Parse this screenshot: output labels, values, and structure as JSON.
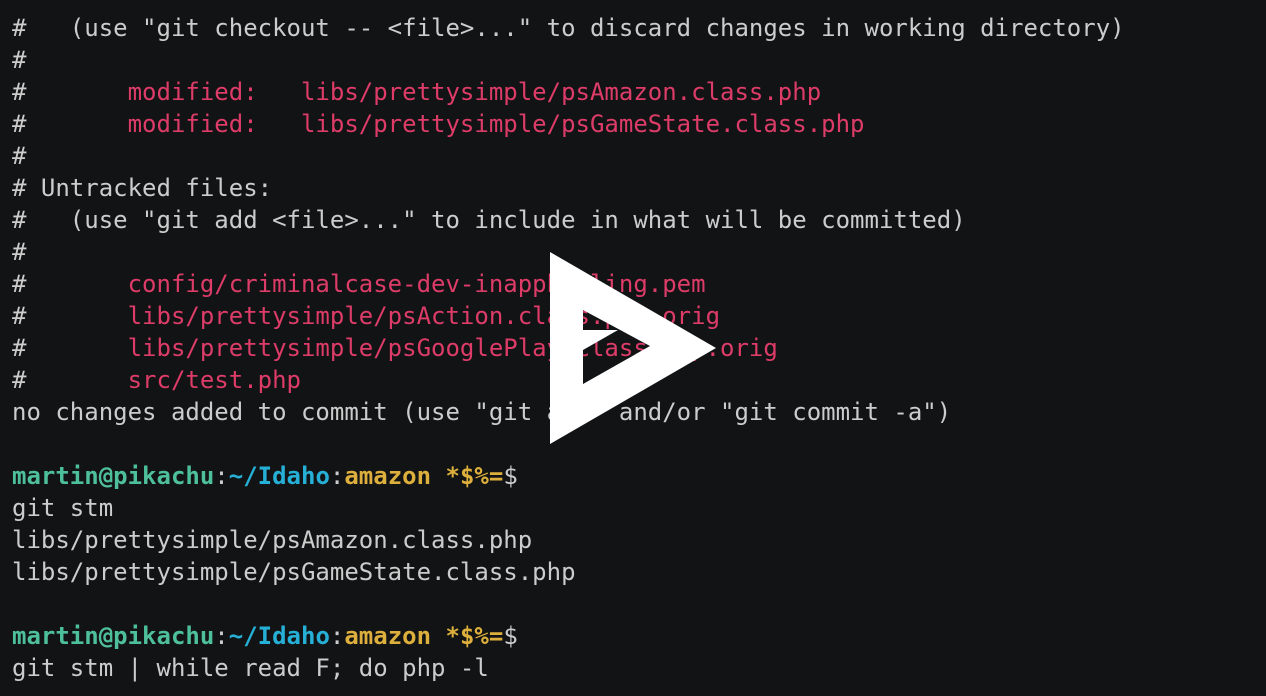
{
  "terminal": {
    "lines": [
      [
        {
          "text": "#   (use \"git checkout -- <file>...\" to discard changes in working directory)",
          "color": "default"
        }
      ],
      [
        {
          "text": "#",
          "color": "default"
        }
      ],
      [
        {
          "text": "#       ",
          "color": "default"
        },
        {
          "text": "modified:   libs/prettysimple/psAmazon.class.php",
          "color": "red"
        }
      ],
      [
        {
          "text": "#       ",
          "color": "default"
        },
        {
          "text": "modified:   libs/prettysimple/psGameState.class.php",
          "color": "red"
        }
      ],
      [
        {
          "text": "#",
          "color": "default"
        }
      ],
      [
        {
          "text": "# Untracked files:",
          "color": "default"
        }
      ],
      [
        {
          "text": "#   (use \"git add <file>...\" to include in what will be committed)",
          "color": "default"
        }
      ],
      [
        {
          "text": "#",
          "color": "default"
        }
      ],
      [
        {
          "text": "#       ",
          "color": "default"
        },
        {
          "text": "config/criminalcase-dev-inappbilling.pem",
          "color": "red"
        }
      ],
      [
        {
          "text": "#       ",
          "color": "default"
        },
        {
          "text": "libs/prettysimple/psAction.class.php.orig",
          "color": "red"
        }
      ],
      [
        {
          "text": "#       ",
          "color": "default"
        },
        {
          "text": "libs/prettysimple/psGooglePlay.class.php.orig",
          "color": "red"
        }
      ],
      [
        {
          "text": "#       ",
          "color": "default"
        },
        {
          "text": "src/test.php",
          "color": "red"
        }
      ],
      [
        {
          "text": "no changes added to commit (use \"git add\" and/or \"git commit -a\")",
          "color": "default"
        }
      ],
      [
        {
          "text": "",
          "color": "default"
        }
      ],
      [
        {
          "text": "martin@pikachu",
          "color": "green"
        },
        {
          "text": ":",
          "color": "default"
        },
        {
          "text": "~/Idaho",
          "color": "blue"
        },
        {
          "text": ":",
          "color": "default"
        },
        {
          "text": "amazon *$%=",
          "color": "yellow"
        },
        {
          "text": "$",
          "color": "default"
        }
      ],
      [
        {
          "text": "git stm",
          "color": "default"
        }
      ],
      [
        {
          "text": "libs/prettysimple/psAmazon.class.php",
          "color": "default"
        }
      ],
      [
        {
          "text": "libs/prettysimple/psGameState.class.php",
          "color": "default"
        }
      ],
      [
        {
          "text": "",
          "color": "default"
        }
      ],
      [
        {
          "text": "martin@pikachu",
          "color": "green"
        },
        {
          "text": ":",
          "color": "default"
        },
        {
          "text": "~/Idaho",
          "color": "blue"
        },
        {
          "text": ":",
          "color": "default"
        },
        {
          "text": "amazon *$%=",
          "color": "yellow"
        },
        {
          "text": "$",
          "color": "default"
        }
      ],
      [
        {
          "text": "git stm | while read F; do php -l",
          "color": "default"
        }
      ]
    ]
  },
  "overlay": {
    "icon": "asciinema-play-icon",
    "color": "#ffffff"
  },
  "colors": {
    "background": "#121314",
    "default": "#cccccc",
    "red": "#dd3c69",
    "green": "#4ebf9b",
    "blue": "#26b0d7",
    "yellow": "#ddaf3c"
  }
}
